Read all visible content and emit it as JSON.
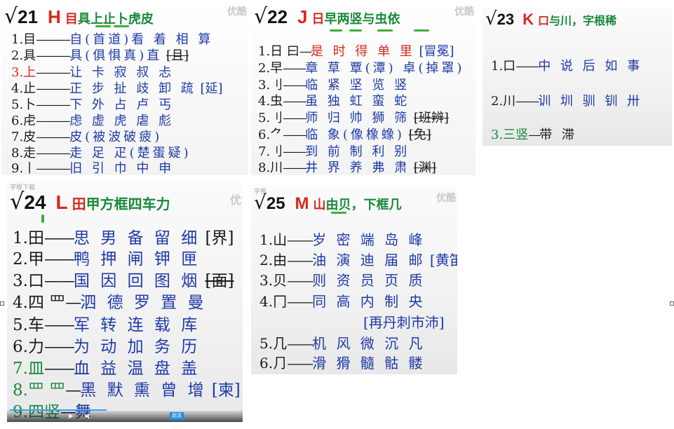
{
  "cards": {
    "c21": {
      "check": "√",
      "num": "21",
      "letter": "H",
      "title_red": "目",
      "title_rest": "具上止卜虎皮",
      "watermark": "优酷",
      "rows": [
        {
          "idx": "1.目",
          "ex": "自(首道)看 着 相 算"
        },
        {
          "idx": "2.具",
          "ex": "具(俱惧真)直",
          "note": "[且]"
        },
        {
          "idx": "3.上",
          "ex": "让 卡 寂 叔 忐"
        },
        {
          "idx": "4.止",
          "ex": "正 步 扯 歧 卸 疏",
          "note": "[延]"
        },
        {
          "idx": "5.卜",
          "ex": "下 外 占 卢 丐"
        },
        {
          "idx": "6.虍",
          "ex": "虑 虚 虎 虐 彪"
        },
        {
          "idx": "7.皮",
          "ex": "皮(被波破疲)"
        },
        {
          "idx": "8.走",
          "ex": "走 足 疋(楚蛋疑)"
        },
        {
          "idx": "9.丨",
          "ex": "旧 引 巾 中 申"
        }
      ]
    },
    "c22": {
      "check": "√",
      "num": "22",
      "letter": "J",
      "title_red": "日",
      "title_rest": "早两竖与虫依",
      "watermark": "优酷",
      "rows": [
        {
          "idx": "1.日 曰",
          "ex": "是 时 得 单 里",
          "note": "[冒冕]"
        },
        {
          "idx": "2.早",
          "ex": "章 草 覃(潭) 卓(掉罩)"
        },
        {
          "idx": "3.刂",
          "ex": "临 紧 坚 览 竖"
        },
        {
          "idx": "4.虫",
          "ex": "虽 独 虹 蛮 蛇"
        },
        {
          "idx": "5.刂",
          "ex": "师 归 帅 狮 筛",
          "note": "[班辨]"
        },
        {
          "idx": "6.⺈",
          "ex": "临 象(像橡蟓)",
          "note": "[免]"
        },
        {
          "idx": "7.刂",
          "ex": "到 前 制 利 别"
        },
        {
          "idx": "8.川",
          "ex": "井 界 养 弗 肃",
          "note": "[渊]"
        }
      ]
    },
    "c23": {
      "check": "√",
      "num": "23",
      "letter": "K",
      "title_red": "口",
      "title_rest": "与川，字根稀",
      "rows": [
        {
          "idx": "1.口",
          "ex": "中 说 后 如 事"
        },
        {
          "idx": "2.川",
          "ex": "训 圳 驯 钏 卅"
        },
        {
          "idx": "3.三竖",
          "ex": "带 滞"
        }
      ]
    },
    "c24": {
      "check": "√",
      "num": "24",
      "letter": "L",
      "title_red": "田",
      "title_rest": "甲方框四车力",
      "watermark": "优",
      "small_label": "字根下载",
      "rows": [
        {
          "idx": "1.田",
          "ex": "思 男 备 留 细",
          "note": "[界]"
        },
        {
          "idx": "2.甲",
          "ex": "鸭 押 闸 钾 匣"
        },
        {
          "idx": "3.口",
          "ex": "国 因 回 图 烟",
          "note": "[面]"
        },
        {
          "idx": "4.四 罒",
          "ex": "泗 德 罗 置 曼"
        },
        {
          "idx": "5.车",
          "ex": "军 转 连 载 库"
        },
        {
          "idx": "6.力",
          "ex": "为 动 加 务 历"
        },
        {
          "idx": "7.皿",
          "ex": "血 益 温 盘 盖"
        },
        {
          "idx": "8.罒 罒",
          "ex": "黑 默 熏 曾 增",
          "note": "[柬]"
        },
        {
          "idx": "9.四竖",
          "ex": "舞"
        }
      ],
      "player": {
        "hd_label": "超清",
        "progress": 0.42
      }
    },
    "c25": {
      "check": "√",
      "num": "25",
      "letter": "M",
      "title_red": "山",
      "title_rest": "由贝，下框几",
      "watermark": "优酷",
      "small_label": "字根",
      "rows": [
        {
          "idx": "1.山",
          "ex": "岁 密 端 岛 峰"
        },
        {
          "idx": "2.由",
          "ex": "油 演 迪 届 邮",
          "note": "[黄笛]"
        },
        {
          "idx": "3.贝",
          "ex": "则 资 员 页 质"
        },
        {
          "idx": "4.冂",
          "ex": "同 高 内 制 央"
        },
        {
          "idx": "",
          "ex": "",
          "note": "[再丹刺市沛]"
        },
        {
          "idx": "5.几",
          "ex": "机 风 微 沉 凡"
        },
        {
          "idx": "6.⺆",
          "ex": "滑 猾 髓 骷 髅"
        }
      ]
    }
  }
}
